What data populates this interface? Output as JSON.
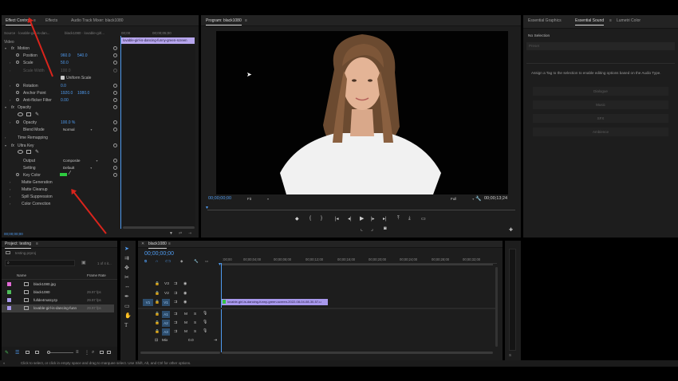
{
  "effect_controls": {
    "tabs": [
      "Effect Controls",
      "Effects",
      "Audio Track Mixer: black1080"
    ],
    "source": "Source · lovable-girl-is-dan...",
    "clip": "black1080 · lovable-girl...",
    "timecodes": [
      "00;00",
      "00;00;05;00"
    ],
    "clip_bar": "lovable-girl-is-dancing-funny-green-screen",
    "video_label": "Video",
    "motion": {
      "label": "Motion",
      "position_label": "Position",
      "position_x": "960.0",
      "position_y": "540.0",
      "scale_label": "Scale",
      "scale": "50.0",
      "scale_width_label": "Scale Width",
      "scale_width": "100.0",
      "uniform_scale": "Uniform Scale",
      "rotation_label": "Rotation",
      "rotation": "0.0",
      "anchor_label": "Anchor Point",
      "anchor_x": "1920.0",
      "anchor_y": "1080.0",
      "antiflicker_label": "Anti-flicker Filter",
      "antiflicker": "0.00"
    },
    "opacity": {
      "label": "Opacity",
      "opacity_label": "Opacity",
      "opacity": "100.0 %",
      "blend_label": "Blend Mode",
      "blend": "Normal"
    },
    "time_remapping": "Time Remapping",
    "ultra_key": {
      "label": "Ultra Key",
      "output_label": "Output",
      "output": "Composite",
      "setting_label": "Setting",
      "setting": "Default",
      "key_color_label": "Key Color",
      "subgroups": [
        "Matte Generation",
        "Matte Cleanup",
        "Spill Suppression",
        "Color Correction"
      ]
    },
    "footer_time": "00;00;00;00"
  },
  "program": {
    "title": "Program: black1080",
    "timecode": "00;00;00;00",
    "fit": "Fit",
    "full": "Full",
    "duration": "00;00;13;24"
  },
  "essential": {
    "tabs": [
      "Essential Graphics",
      "Essential Sound",
      "Lumetri Color"
    ],
    "no_selection": "No Selection",
    "preset": "Preset",
    "assign_text": "Assign a Tag to the selection to enable editing options based on the Audio Type.",
    "buttons": [
      "Dialogue",
      "Music",
      "SFX",
      "Ambience"
    ]
  },
  "project": {
    "title": "Project: testing",
    "file": "testing.prproj",
    "count": "1 of 4 it...",
    "col_name": "Name",
    "col_rate": "Frame Rate",
    "items": [
      {
        "name": "black1080.jpg",
        "rate": "",
        "color": "#e26ad6"
      },
      {
        "name": "black1080",
        "rate": "29.97 fps",
        "color": "#4ebd5a"
      },
      {
        "name": "fullde4matcyzp",
        "rate": "29.97 fps",
        "color": "#a898ec"
      },
      {
        "name": "lovable-girl-is-dancing-funn",
        "rate": "29.97 fps",
        "color": "#a898ec"
      }
    ]
  },
  "timeline": {
    "title": "black1080",
    "timecode": "00;00;00;00",
    "ruler": [
      ":00;00",
      "00;00;04;00",
      "00;00;08;00",
      "00;00;12;00",
      "00;00;16;00",
      "00;00;20;00",
      "00;00;24;00",
      "00;00;28;00",
      "00;00;32;00"
    ],
    "video_tracks": [
      "V3",
      "V2",
      "V1"
    ],
    "audio_tracks": [
      "A1",
      "A2",
      "A3"
    ],
    "source_patch": "V1",
    "clip_name": "lovable-girl-is-dancing-funny-green-screen-2022-08-04-08-30-57-u",
    "mix": "Mix",
    "mix_value": "0.0"
  },
  "status_bar": "Click to select, or click in empty space and drag to marquee select. Use Shift, Alt, and Ctrl for other options.",
  "colors": {
    "accent": "#4f9bf0",
    "clip_violet": "#a898ec",
    "key_green": "#2ecc40",
    "arrow": "#d9241c"
  }
}
